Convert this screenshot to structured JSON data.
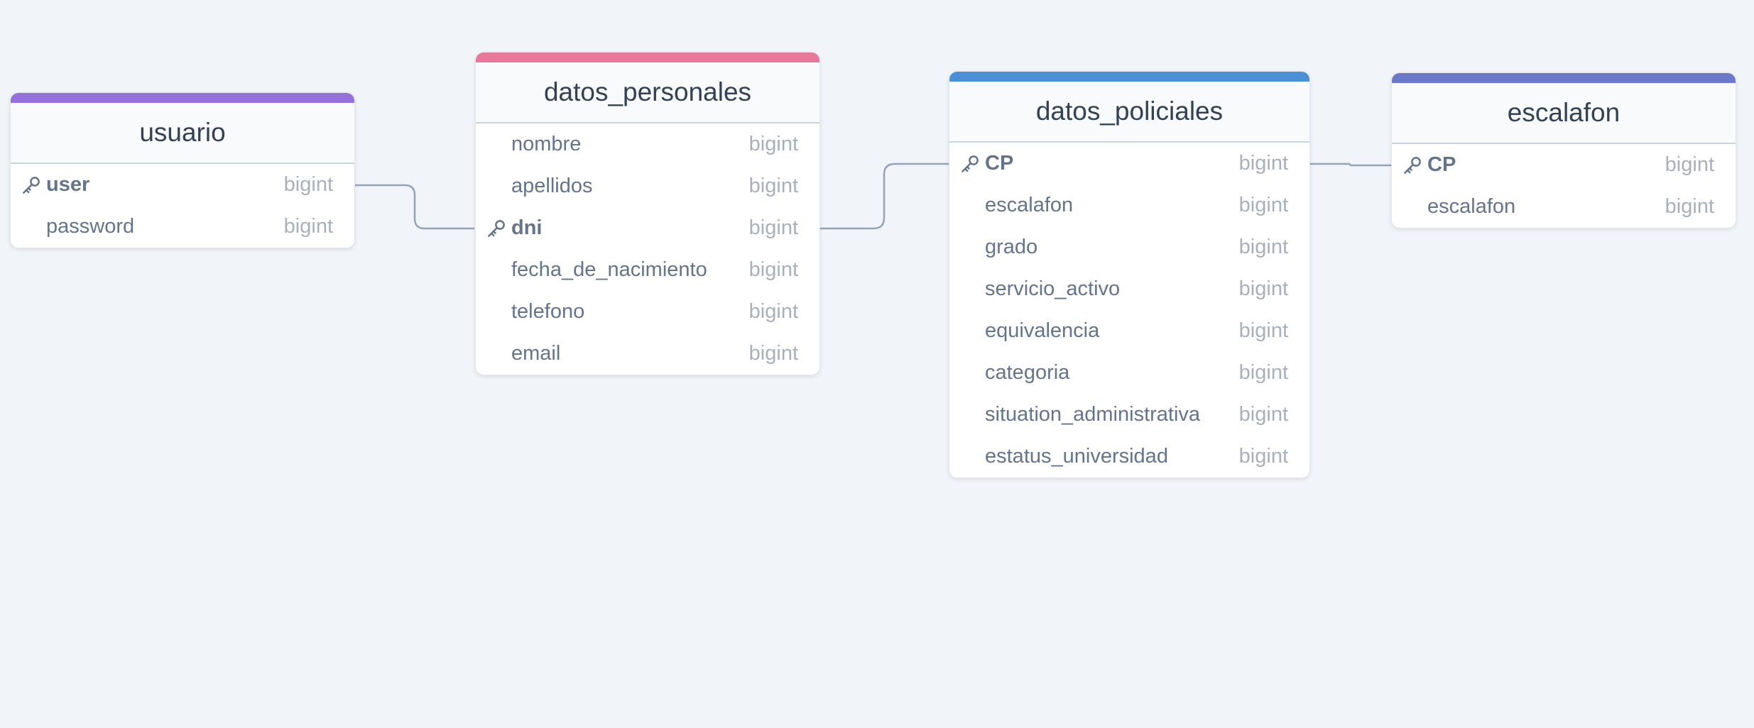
{
  "colors": {
    "background": "#f1f5f9",
    "connector": "#94a3b8",
    "usuario_accent": "#9370db",
    "datos_personales_accent": "#e8779b",
    "datos_policiales_accent": "#4a90d9",
    "escalafon_accent": "#6c78c8"
  },
  "tables": {
    "usuario": {
      "name": "usuario",
      "fields": [
        {
          "name": "user",
          "type": "bigint",
          "pk": true
        },
        {
          "name": "password",
          "type": "bigint",
          "pk": false
        }
      ]
    },
    "datos_personales": {
      "name": "datos_personales",
      "fields": [
        {
          "name": "nombre",
          "type": "bigint",
          "pk": false
        },
        {
          "name": "apellidos",
          "type": "bigint",
          "pk": false
        },
        {
          "name": "dni",
          "type": "bigint",
          "pk": true
        },
        {
          "name": "fecha_de_nacimiento",
          "type": "bigint",
          "pk": false
        },
        {
          "name": "telefono",
          "type": "bigint",
          "pk": false
        },
        {
          "name": "email",
          "type": "bigint",
          "pk": false
        }
      ]
    },
    "datos_policiales": {
      "name": "datos_policiales",
      "fields": [
        {
          "name": "CP",
          "type": "bigint",
          "pk": true
        },
        {
          "name": "escalafon",
          "type": "bigint",
          "pk": false
        },
        {
          "name": "grado",
          "type": "bigint",
          "pk": false
        },
        {
          "name": "servicio_activo",
          "type": "bigint",
          "pk": false
        },
        {
          "name": "equivalencia",
          "type": "bigint",
          "pk": false
        },
        {
          "name": "categoria",
          "type": "bigint",
          "pk": false
        },
        {
          "name": "situation_administrativa",
          "type": "bigint",
          "pk": false
        },
        {
          "name": "estatus_universidad",
          "type": "bigint",
          "pk": false
        }
      ]
    },
    "escalafon": {
      "name": "escalafon",
      "fields": [
        {
          "name": "CP",
          "type": "bigint",
          "pk": true
        },
        {
          "name": "escalafon",
          "type": "bigint",
          "pk": false
        }
      ]
    }
  }
}
